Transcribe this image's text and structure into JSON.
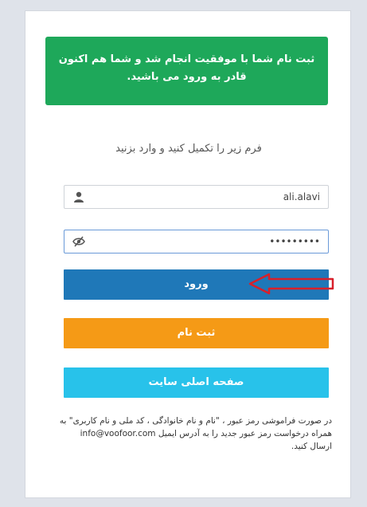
{
  "alert": {
    "message": "ثبت نام شما با موفقیت انجام شد و شما هم اکنون قادر به ورود می باشید."
  },
  "form": {
    "instruction": "فرم زیر را تکمیل کنید و وارد بزنید",
    "username_value": "ali.alavi",
    "password_value": "•••••••••",
    "login_label": "ورود",
    "signup_label": "ثبت نام",
    "home_label": "صفحه اصلی سایت"
  },
  "footer": {
    "note": "در صورت فراموشی رمز عبور ، \"نام و نام خانوادگی ، کد ملی و نام کاربری\" به همراه درخواست رمز عبور جدید را به آدرس ایمیل info@voofoor.com ارسال کنید."
  },
  "icons": {
    "user": "user-icon",
    "password": "eye-slash-icon",
    "annotation": "red-arrow-icon"
  },
  "colors": {
    "success": "#1ea85a",
    "login": "#1f78b8",
    "signup": "#f59a16",
    "home": "#28c2ea",
    "arrow": "#d8202a"
  }
}
